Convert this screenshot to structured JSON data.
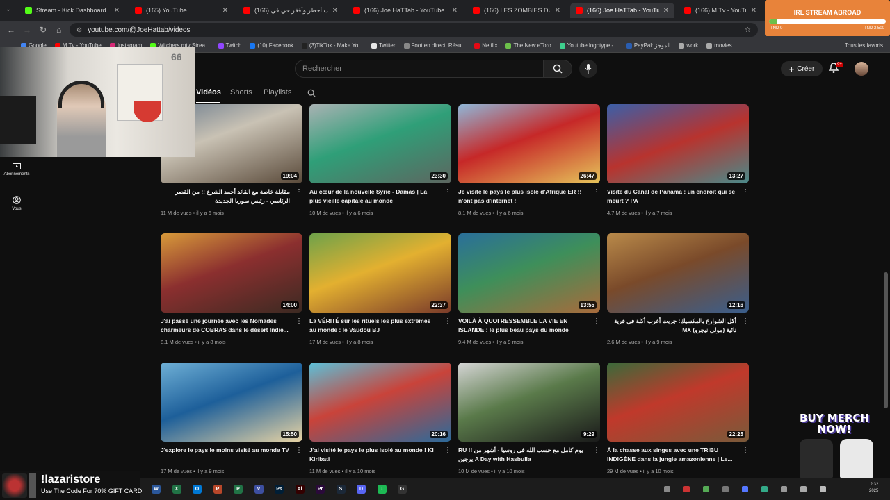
{
  "browser": {
    "tabs": [
      {
        "title": "Stream - Kick Dashboard",
        "fav_color": "#53fc18",
        "active": false
      },
      {
        "title": "(165) YouTube",
        "fav_color": "#ff0000",
        "active": false
      },
      {
        "title": "(166) دخلت أخطر وأفقر حي في",
        "fav_color": "#ff0000",
        "active": false
      },
      {
        "title": "(166) Joe HaTTab - YouTube",
        "fav_color": "#ff0000",
        "active": false
      },
      {
        "title": "(166) LES ZOMBIES DU CANAD",
        "fav_color": "#ff0000",
        "active": false
      },
      {
        "title": "(166) Joe HaTTab - YouTube",
        "fav_color": "#ff0000",
        "active": true
      },
      {
        "title": "(166) M Tv - YouTube",
        "fav_color": "#ff0000",
        "active": false
      }
    ],
    "url": "youtube.com/@JoeHattab/videos",
    "bookmarks": [
      {
        "label": "Google",
        "color": "#4285f4"
      },
      {
        "label": "M Tv - YouTube",
        "color": "#ff0000"
      },
      {
        "label": "Instagram",
        "color": "#d62976"
      },
      {
        "label": "Witchers mtv Strea...",
        "color": "#53fc18"
      },
      {
        "label": "Twitch",
        "color": "#9146ff"
      },
      {
        "label": "(10) Facebook",
        "color": "#1877f2"
      },
      {
        "label": "(3)TikTok - Make Yo...",
        "color": "#222222"
      },
      {
        "label": "Twitter",
        "color": "#e7e7e7"
      },
      {
        "label": "Foot en direct, Résu...",
        "color": "#888888"
      },
      {
        "label": "Netflix",
        "color": "#e50914"
      },
      {
        "label": "The New eToro",
        "color": "#6cc04a"
      },
      {
        "label": "Youtube logotype -...",
        "color": "#3ecf8e"
      },
      {
        "label": "PayPal: الموجز",
        "color": "#2a5db0"
      },
      {
        "label": "work",
        "color": "#aaaaaa"
      },
      {
        "label": "movies",
        "color": "#aaaaaa"
      }
    ],
    "all_bookmarks": "Tous les favoris"
  },
  "overlay": {
    "title": "IRL STREAM ABROAD",
    "progress_fraction": 0.07,
    "min_label": "TND 0",
    "max_label": "TND 2,500"
  },
  "youtube": {
    "search_placeholder": "Rechercher",
    "create_label": "Créer",
    "notif_count": "9+",
    "tabs": [
      {
        "label": "Vidéos",
        "active": true
      },
      {
        "label": "Shorts",
        "active": false
      },
      {
        "label": "Playlists",
        "active": false
      }
    ],
    "rail": [
      {
        "label": "Abonnements"
      },
      {
        "label": "Vous"
      }
    ],
    "videos": [
      {
        "title": "مقابلة خاصة مع القائد أحمد الشرع !! من القصر الرئاسي - رئيس سوريا الجديدة",
        "rtl": true,
        "views": "11 M de vues",
        "age": "il y a 6 mois",
        "duration": "19:04",
        "bg": "linear-gradient(160deg,#6d7d8e,#c9c2b4 40%,#5a4a3a)"
      },
      {
        "title": "Au cœur de la nouvelle Syrie - Damas | La plus vieille capitale au monde",
        "rtl": false,
        "views": "10 M de vues",
        "age": "il y a 6 mois",
        "duration": "23:30",
        "bg": "linear-gradient(160deg,#a9b2b3,#2f9f78 45%,#5d6660)"
      },
      {
        "title": "Je visite le pays le plus isolé d'Afrique ER !! n'ont pas d'internet !",
        "rtl": false,
        "views": "8,1 M de vues",
        "age": "il y a 6 mois",
        "duration": "26:47",
        "bg": "linear-gradient(160deg,#8fb7d8,#c62828 45%,#e6c45a)"
      },
      {
        "title": "Visite du Canal de Panama : un endroit qui se meurt ? PA",
        "rtl": false,
        "views": "4,7 M de vues",
        "age": "il y a 7 mois",
        "duration": "13:27",
        "bg": "linear-gradient(160deg,#3b5fa8,#b8332e 50%,#4a8a8a)"
      },
      {
        "title": "J'ai passé une journée avec les Nomades charmeurs de COBRAS dans le désert Indie...",
        "rtl": false,
        "views": "8,1 M de vues",
        "age": "il y a 8 mois",
        "duration": "14:00",
        "bg": "linear-gradient(160deg,#d89a3a,#8b2f2f 45%,#3c2a22)"
      },
      {
        "title": "La VÉRITÉ sur les rituels les plus extrêmes au monde : le Vaudou BJ",
        "rtl": false,
        "views": "17 M de vues",
        "age": "il y a 8 mois",
        "duration": "22:37",
        "bg": "linear-gradient(160deg,#6ea24a,#e3b030 45%,#7a3b2a)"
      },
      {
        "title": "VOILÀ À QUOI RESSEMBLE LA VIE EN ISLANDE : le plus beau pays du monde",
        "rtl": false,
        "views": "9,4 M de vues",
        "age": "il y a 9 mois",
        "duration": "13:55",
        "bg": "linear-gradient(160deg,#2a6f9a,#3e8f5a 45%,#a86b3c)"
      },
      {
        "title": "أكل الشوارع بالمكسيك: جربت أغرب أكلة في قرية نائية (مولي نيجرو) MX",
        "rtl": true,
        "views": "2,6 M de vues",
        "age": "il y a 9 mois",
        "duration": "12:16",
        "bg": "linear-gradient(160deg,#b98a4a,#7a4a2a 45%,#3a5e8c)"
      },
      {
        "title": "J'explore le pays le moins visité au monde TV",
        "rtl": false,
        "views": "17 M de vues",
        "age": "il y a 9 mois",
        "duration": "15:50",
        "bg": "linear-gradient(160deg,#6fb0d6,#1d5f9a 45%,#e7d3a4)"
      },
      {
        "title": "J'ai visité le pays le plus isolé au monde ! KI Kiribati",
        "rtl": false,
        "views": "11 M de vues",
        "age": "il y a 10 mois",
        "duration": "20:16",
        "bg": "linear-gradient(160deg,#5cc0d8,#c9433a 45%,#2c6a9a)"
      },
      {
        "title": "RU !! يوم كامل مع حسب الله في روسيا - أشهر من يرجين A Day with Hasbulla",
        "rtl": false,
        "views": "10 M de vues",
        "age": "il y a 10 mois",
        "duration": "9:29",
        "bg": "linear-gradient(160deg,#d5d5d5,#5a7a4a 45%,#1a1a1a)"
      },
      {
        "title": "À la chasse aux singes avec une TRIBU INDIGÈNE dans la jungle amazonienne | Le...",
        "rtl": false,
        "views": "29 M de vues",
        "age": "il y a 10 mois",
        "duration": "22:25",
        "bg": "linear-gradient(160deg,#3a6a3a,#c0392b 45%,#7a5a3a)"
      }
    ]
  },
  "webcam": {
    "counter": "66"
  },
  "store": {
    "name": "!lazaristore",
    "promo": "Use The Code For 70% GIFT CARD"
  },
  "merch": {
    "text": "BUY MERCH NOW!"
  },
  "taskbar": {
    "apps": [
      "W",
      "X",
      "O",
      "P",
      "P",
      "V",
      "Ps",
      "Ai",
      "Pr",
      "S",
      "D",
      "♪",
      "G"
    ],
    "time": "2:32",
    "date": "2025"
  }
}
